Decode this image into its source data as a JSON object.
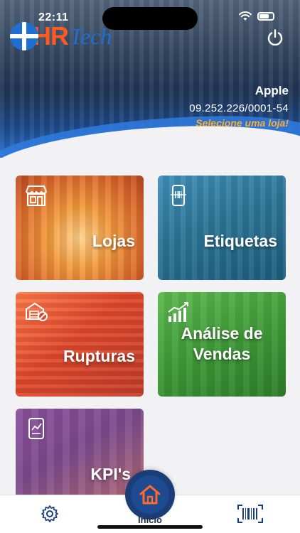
{
  "status_bar": {
    "time": "22:11"
  },
  "header": {
    "logo": {
      "hr": "HR",
      "tech": "Tech"
    },
    "company_name": "Apple",
    "cnpj": "09.252.226/0001-54",
    "store_hint": "Selecione uma loja!",
    "colors": {
      "hint": "#ffad2e",
      "brand_orange": "#ff5a1f",
      "brand_blue": "#1f6fd1"
    }
  },
  "tiles": [
    {
      "label": "Lojas",
      "icon": "store-icon"
    },
    {
      "label": "Etiquetas",
      "icon": "barcode-scanner-icon"
    },
    {
      "label": "Rupturas",
      "icon": "out-of-stock-icon"
    },
    {
      "label": "Análise de Vendas",
      "icon": "sales-chart-icon"
    },
    {
      "label": "KPI's",
      "icon": "kpi-tablet-icon"
    }
  ],
  "tab_bar": {
    "home_label": "Início",
    "active_color": "#1c3e78"
  }
}
